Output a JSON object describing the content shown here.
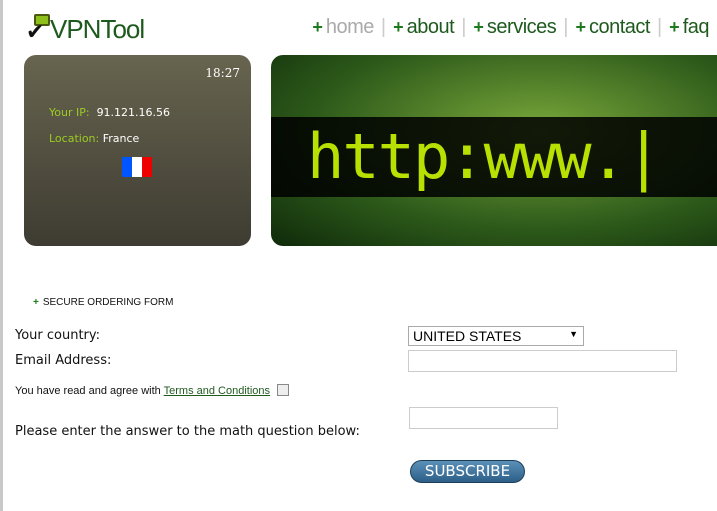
{
  "brand": {
    "name": "VPNTool"
  },
  "nav": [
    {
      "label": "home",
      "active": true
    },
    {
      "label": "about"
    },
    {
      "label": "services"
    },
    {
      "label": "contact"
    },
    {
      "label": "faq"
    }
  ],
  "status": {
    "time": "18:27",
    "ip_label": "Your IP:",
    "ip": "91.121.16.56",
    "location_label": "Location:",
    "location": "France",
    "flag_colors": [
      "#0055ff",
      "#ffffff",
      "#ee0000"
    ]
  },
  "banner": {
    "text": "http:www.|"
  },
  "form": {
    "title": "SECURE ORDERING FORM",
    "country_label": "Your country:",
    "country_value": "UNITED STATES",
    "email_label": "Email Address:",
    "email_value": "",
    "terms_prefix": "You have read and agree with",
    "terms_link": "Terms and Conditions",
    "terms_checked": false,
    "math_label": "Please enter the answer to the math question below:",
    "math_value": "",
    "submit": "SUBSCRIBE"
  },
  "colors": {
    "brand_green": "#1e5a1e",
    "accent_lime": "#9ccc22",
    "button_blue": "#2d5f88"
  }
}
